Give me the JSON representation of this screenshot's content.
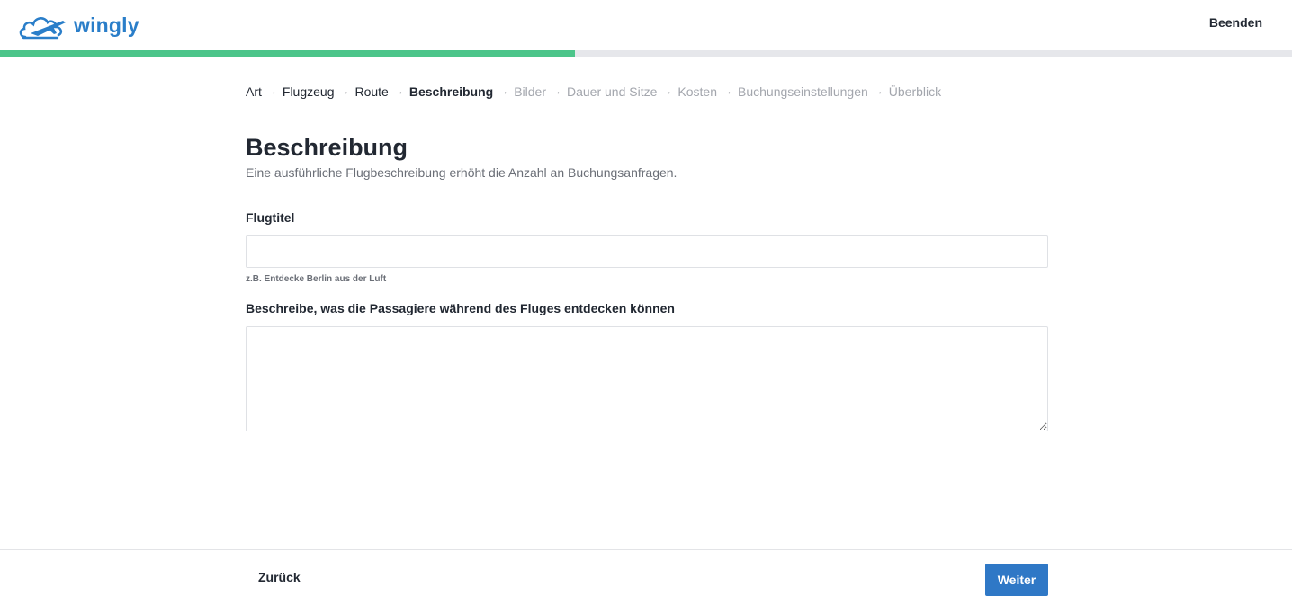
{
  "brand": {
    "name": "wingly",
    "color": "#2a7ec9"
  },
  "header": {
    "exit_label": "Beenden"
  },
  "progress": {
    "fraction": 0.445,
    "color": "#4cc58a"
  },
  "breadcrumb": [
    {
      "label": "Art",
      "state": "done"
    },
    {
      "label": "Flugzeug",
      "state": "done"
    },
    {
      "label": "Route",
      "state": "done"
    },
    {
      "label": "Beschreibung",
      "state": "current"
    },
    {
      "label": "Bilder",
      "state": "future"
    },
    {
      "label": "Dauer und Sitze",
      "state": "future"
    },
    {
      "label": "Kosten",
      "state": "future"
    },
    {
      "label": "Buchungseinstellungen",
      "state": "future"
    },
    {
      "label": "Überblick",
      "state": "future"
    }
  ],
  "page": {
    "title": "Beschreibung",
    "subtitle": "Eine ausführliche Flugbeschreibung erhöht die Anzahl an Buchungsanfragen."
  },
  "form": {
    "flight_title": {
      "label": "Flugtitel",
      "value": "",
      "hint": "z.B. Entdecke Berlin aus der Luft"
    },
    "description": {
      "label": "Beschreibe, was die Passagiere während des Fluges entdecken können",
      "value": ""
    }
  },
  "footer": {
    "back_label": "Zurück",
    "next_label": "Weiter",
    "next_color": "#2f78c6"
  },
  "icons": {
    "logo": "cloud-plane-logo-icon",
    "separator": "arrow-right-icon"
  }
}
